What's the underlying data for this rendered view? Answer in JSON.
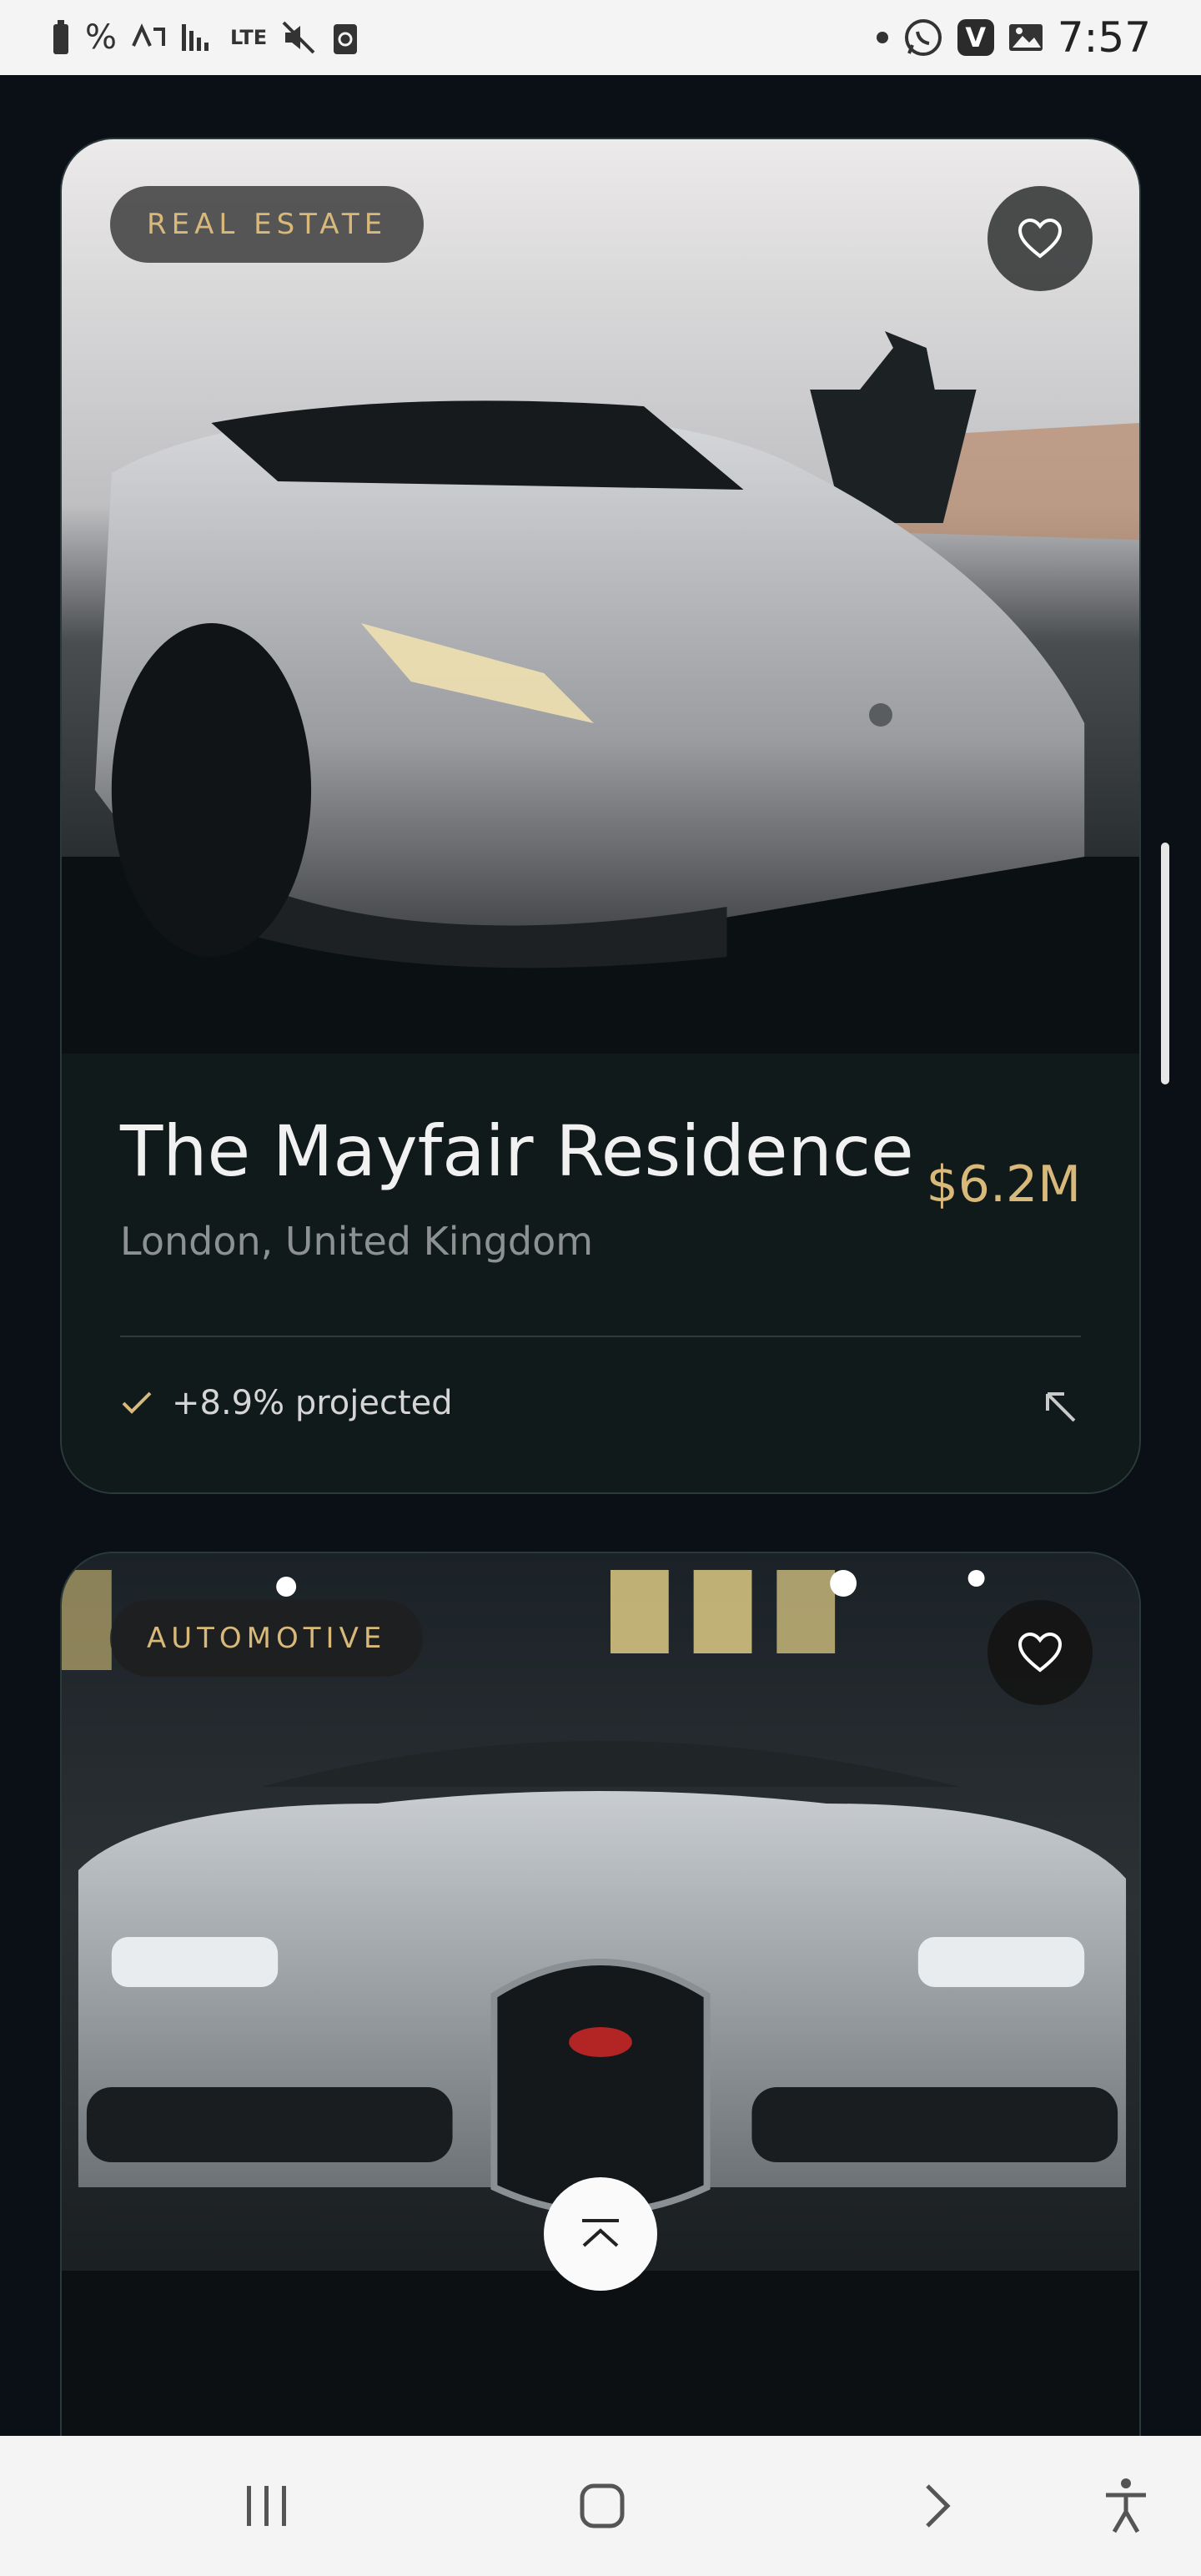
{
  "status_bar": {
    "left_text": "%",
    "network": "LTE",
    "time": "7:57",
    "notification_box": "V"
  },
  "cards": [
    {
      "category": "REAL ESTATE",
      "title": "The Mayfair Residence",
      "location": "London, United Kingdom",
      "price": "$6.2M",
      "projection": "+8.9% projected"
    },
    {
      "category": "AUTOMOTIVE"
    }
  ],
  "icons": {
    "favorite": "heart-icon",
    "check": "check-icon",
    "open": "arrow-up-left-icon",
    "scroll_top": "chevron-up-icon",
    "nav_recents": "recents-icon",
    "nav_home": "home-icon",
    "nav_back": "back-icon",
    "nav_accessibility": "accessibility-icon"
  },
  "colors": {
    "accent_gold": "#d8b97a",
    "background": "#0a1015",
    "card": "#111a1a"
  }
}
